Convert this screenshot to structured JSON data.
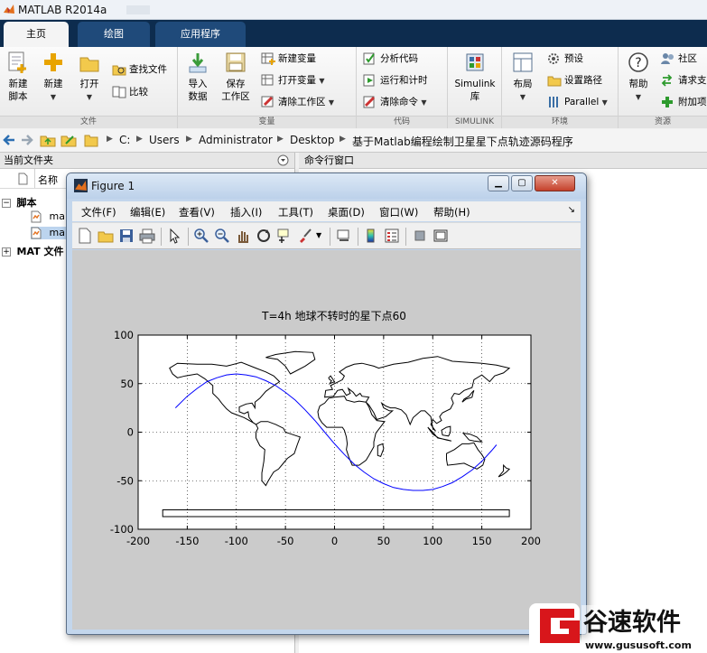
{
  "window": {
    "title": "MATLAB R2014a"
  },
  "ribbon_tabs": [
    {
      "label": "主页",
      "active": true
    },
    {
      "label": "绘图",
      "active": false
    },
    {
      "label": "应用程序",
      "active": false
    }
  ],
  "ribbon": {
    "file": {
      "label": "文件",
      "new_script": [
        "新建",
        "脚本"
      ],
      "new": "新建",
      "open": "打开",
      "find_files": "查找文件",
      "compare": "比较"
    },
    "variable": {
      "label": "变量",
      "import": [
        "导入",
        "数据"
      ],
      "save": [
        "保存",
        "工作区"
      ],
      "new_variable": "新建变量",
      "open_variable": "打开变量",
      "clear_workspace": "清除工作区"
    },
    "code": {
      "label": "代码",
      "analyze": "分析代码",
      "run_time": "运行和计时",
      "clear_commands": "清除命令"
    },
    "simulink": {
      "label": "SIMULINK",
      "button": [
        "Simulink",
        "库"
      ]
    },
    "environment": {
      "label": "环境",
      "layout": "布局",
      "preferences": "预设",
      "set_path": "设置路径",
      "parallel": "Parallel"
    },
    "resources": {
      "label": "资源",
      "help": "帮助",
      "community": "社区",
      "request": "请求支",
      "addons": "附加项"
    }
  },
  "address_bar": {
    "path": [
      "C:",
      "Users",
      "Administrator",
      "Desktop",
      "基于Matlab编程绘制卫星星下点轨迹源码程序"
    ]
  },
  "left_panel": {
    "title": "当前文件夹",
    "column_name": "名称",
    "tree": [
      {
        "label": "脚本",
        "type": "group"
      },
      {
        "label": "ma",
        "type": "file"
      },
      {
        "label": "ma",
        "type": "file"
      },
      {
        "label": "MAT 文件",
        "type": "group"
      }
    ]
  },
  "right_panel": {
    "title": "命令行窗口"
  },
  "figure": {
    "title": "Figure 1",
    "menu": [
      "文件(F)",
      "编辑(E)",
      "查看(V)",
      "插入(I)",
      "工具(T)",
      "桌面(D)",
      "窗口(W)",
      "帮助(H)"
    ],
    "toolbar_icons": [
      "new-figure-icon",
      "open-file-icon",
      "save-icon",
      "print-icon",
      "edit-plot-icon",
      "zoom-in-icon",
      "zoom-out-icon",
      "pan-icon",
      "rotate-3d-icon",
      "data-cursor-icon",
      "brush-icon",
      "link-plot-icon",
      "colorbar-icon",
      "legend-icon",
      "hide-plot-tools-icon",
      "show-plot-tools-icon"
    ]
  },
  "chart_data": {
    "type": "line",
    "title": "T=4h 地球不转时的星下点60",
    "xlabel": "",
    "ylabel": "",
    "xlim": [
      -200,
      200
    ],
    "ylim": [
      -100,
      100
    ],
    "xticks": [
      -200,
      -150,
      -100,
      -50,
      0,
      50,
      100,
      150,
      200
    ],
    "yticks": [
      -100,
      -50,
      0,
      50,
      100
    ],
    "grid": true,
    "series": [
      {
        "color": "#0000ff",
        "x": [
          -162,
          -150,
          -140,
          -130,
          -120,
          -110,
          -100,
          -90,
          -80,
          -70,
          -60,
          -50,
          -40,
          -30,
          -20,
          -10,
          0,
          10,
          20,
          30,
          40,
          50,
          60,
          70,
          80,
          90,
          100,
          110,
          120,
          130,
          140,
          150,
          160,
          165
        ],
        "y": [
          25,
          37,
          45,
          52,
          56,
          59,
          60,
          59,
          57,
          53,
          48,
          41,
          33,
          23,
          12,
          0,
          -12,
          -23,
          -33,
          -41,
          -48,
          -53,
          -57,
          -59,
          -60,
          -60,
          -59,
          -56,
          -52,
          -46,
          -39,
          -30,
          -19,
          -13
        ]
      }
    ],
    "background_layer": "world-coastline-map"
  },
  "watermark": {
    "text": "谷速软件",
    "url": "www.gususoft.com"
  },
  "colors": {
    "ribbon_dark": "#0d2c4e",
    "figure_frame": "#c3d6ec",
    "plot_line": "#0000ff",
    "watermark_red": "#d8161b"
  }
}
